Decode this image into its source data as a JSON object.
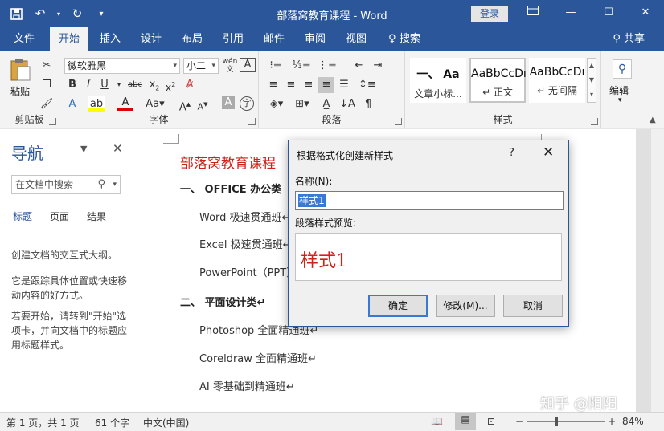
{
  "titlebar": {
    "title": "部落窝教育课程 - Word",
    "login": "登录"
  },
  "tabs": {
    "file": "文件",
    "home": "开始",
    "insert": "插入",
    "design": "设计",
    "layout": "布局",
    "references": "引用",
    "mailings": "邮件",
    "review": "审阅",
    "view": "视图",
    "tell": "搜索",
    "share": "共享"
  },
  "ribbon": {
    "clipboard": {
      "paste": "粘贴",
      "label": "剪贴板"
    },
    "font": {
      "name": "微软雅黑",
      "size": "小二",
      "label": "字体"
    },
    "paragraph": {
      "label": "段落"
    },
    "styles": {
      "label": "样式",
      "items": [
        {
          "preview": "一、 Aa",
          "name": "文章小标..."
        },
        {
          "preview": "AaBbCcDı",
          "name": "↵ 正文"
        },
        {
          "preview": "AaBbCcDı",
          "name": "↵ 无间隔"
        }
      ]
    },
    "editing": {
      "label": "编辑"
    }
  },
  "nav": {
    "title": "导航",
    "search_placeholder": "在文档中搜索",
    "tabs": [
      "标题",
      "页面",
      "结果"
    ],
    "text1": "创建文档的交互式大纲。",
    "text2": "它是跟踪具体位置或快速移动内容的好方式。",
    "text3": "若要开始，请转到\"开始\"选项卡，并向文档中的标题应用标题样式。"
  },
  "document": {
    "title": "部落窝教育课程",
    "h1": "一、 OFFICE 办公类",
    "items1": [
      "Word 极速贯通班↵",
      "Excel 极速贯通班↵",
      "PowerPoint（PPT）"
    ],
    "h2": "二、 平面设计类↵",
    "items2": [
      "Photoshop 全面精通班↵",
      "Coreldraw 全面精通班↵",
      "AI 零基础到精通班↵"
    ]
  },
  "dialog": {
    "title": "根据格式化创建新样式",
    "help": "?",
    "name_label": "名称(N):",
    "name_value": "样式1",
    "preview_label": "段落样式预览:",
    "preview_text": "样式1",
    "ok": "确定",
    "modify": "修改(M)...",
    "cancel": "取消"
  },
  "status": {
    "page": "第 1 页，共 1 页",
    "words": "61 个字",
    "lang": "中文(中国)",
    "zoom": "84%"
  },
  "watermark": "知乎 @阳阳"
}
